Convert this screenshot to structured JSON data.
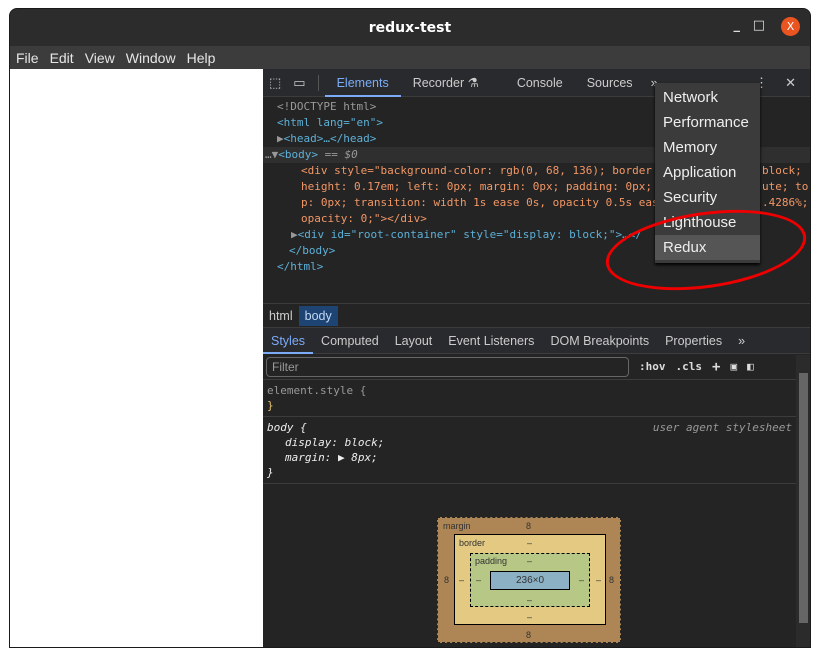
{
  "window": {
    "title": "redux-test",
    "minimize": "_",
    "maximize": "□",
    "close": "X"
  },
  "menubar": [
    "File",
    "Edit",
    "View",
    "Window",
    "Help"
  ],
  "devtools": {
    "tabs": [
      "Elements",
      "Recorder",
      "Console",
      "Sources"
    ],
    "more": "»",
    "code": {
      "doctype": "<!DOCTYPE html>",
      "html_open": "<html lang=\"en\">",
      "head": "<head>…</head>",
      "body_prefix": "…",
      "body": "<body>",
      "body_eq": " == $0",
      "div1_l1": "<div style=\"background-color: rgb(0, 68, 136); border",
      "div1_l1b": "block;",
      "div1_l2": "height: 0.17em; left: 0px; margin: 0px; padding: 0px;",
      "div1_l2b": "ute; to",
      "div1_l3": "p: 0px; transition: width 1s ease 0s, opacity 0.5s eas",
      "div1_l3b": ".4286%;",
      "div1_l4": "opacity: 0;\"></div>",
      "div2": "<div id=\"root-container\" style=\"display: block;\">…</",
      "body_close": "</body>",
      "html_close": "</html>"
    },
    "breadcrumbs": [
      "html",
      "body"
    ],
    "style_tabs": [
      "Styles",
      "Computed",
      "Layout",
      "Event Listeners",
      "DOM Breakpoints",
      "Properties"
    ],
    "filter_placeholder": "Filter",
    "hov": ":hov",
    "cls": ".cls",
    "element_style": "element.style {",
    "close_brace": "}",
    "body_rule": {
      "selector": "body {",
      "source": "user agent stylesheet",
      "props": [
        "display: block;",
        "margin: ▶ 8px;"
      ]
    },
    "box_model": {
      "margin_label": "margin",
      "border_label": "border",
      "padding_label": "padding",
      "margin": [
        "8",
        "8",
        "8",
        "8"
      ],
      "border": "–",
      "padding": "–",
      "content": "236×0"
    }
  },
  "dropdown": {
    "items": [
      "Network",
      "Performance",
      "Memory",
      "Application",
      "Security",
      "Lighthouse",
      "Redux"
    ],
    "highlighted": "Redux"
  }
}
